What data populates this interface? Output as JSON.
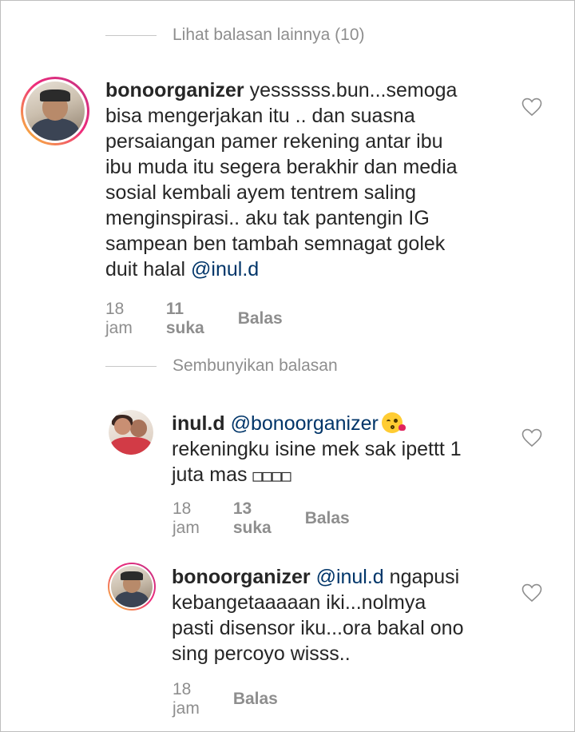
{
  "view_replies_label": "Lihat balasan lainnya (10)",
  "hide_replies_label": "Sembunyikan balasan",
  "comments": [
    {
      "username": "bonoorganizer",
      "lines": [
        "yessssss.bun...semoga",
        "bisa mengerjakan itu .. dan suasna",
        "persaiangan pamer rekening antar ibu",
        "ibu muda itu segera berakhir dan media",
        "sosial kembali ayem tentrem saling",
        "menginspirasi.. aku tak pantengin IG",
        "sampean ben tambah semnagat golek",
        "duit halal "
      ],
      "mention": "@inul.d",
      "time": "18 jam",
      "likes": "11 suka",
      "reply": "Balas"
    },
    {
      "username": "inul.d",
      "mention": "@bonoorganizer",
      "lines": [
        "rekeningku isine mek sak ipettt 1",
        "juta mas ",
        "□□□□"
      ],
      "time": "18 jam",
      "likes": "13 suka",
      "reply": "Balas"
    },
    {
      "username": "bonoorganizer",
      "mention": "@inul.d",
      "lines": [
        " ngapusi",
        "kebangetaaaaan iki...nolmya",
        "pasti disensor iku...ora bakal ono",
        "sing percoyo  wisss.."
      ],
      "time": "18 jam",
      "reply": "Balas"
    }
  ],
  "icons": {
    "heart": "heart-outline-icon",
    "emoji": "kissing-face-emoji"
  },
  "colors": {
    "text": "#262626",
    "muted": "#8e8e8e",
    "mention": "#003569",
    "ring_start": "#f9ce34",
    "ring_end": "#c13584"
  }
}
